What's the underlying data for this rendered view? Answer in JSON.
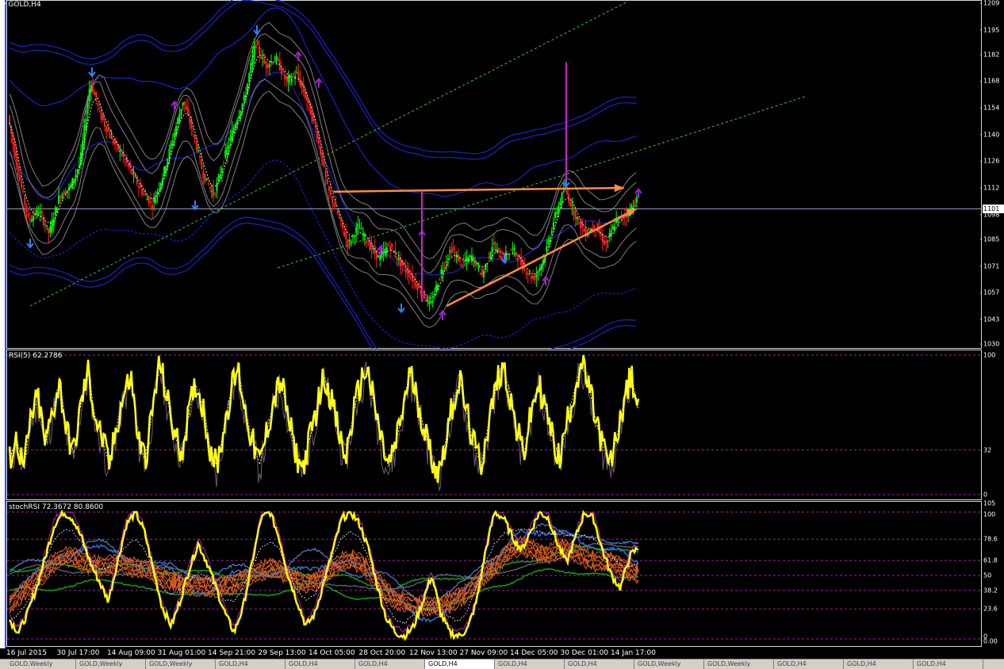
{
  "window": {
    "title": "GOLD,H4"
  },
  "colors": {
    "background": "#000000",
    "bull_candle": "#00ff00",
    "bear_candle": "#ff2020",
    "bollinger": "#1a22c8",
    "envelope": "#808080",
    "trend_orange": "#ff8c40",
    "magenta": "#d020d0",
    "channel_green": "#33cc33",
    "rsi": "#ffff00",
    "stoch_orange": "#e06020",
    "stoch_blue": "#3070e0",
    "stoch_green": "#10a010",
    "level_line": "#a020a0"
  },
  "chart_data": [
    {
      "type": "line",
      "title": "GOLD,H4",
      "ylim": [
        1030,
        1209
      ],
      "yticks": [
        "1209",
        "1195",
        "1182",
        "1168",
        "1154",
        "1140",
        "1126",
        "1112",
        "1098",
        "1085",
        "1071",
        "1057",
        "1043",
        "1030"
      ],
      "ytick_values": [
        1209,
        1195,
        1182,
        1168,
        1154,
        1140,
        1126,
        1112,
        1098,
        1085,
        1071,
        1057,
        1043,
        1030
      ],
      "current_price": 1101.0,
      "current_price_label": "1101",
      "x_labels": [
        "16 Jul 2015",
        "30 Jul 17:00",
        "14 Aug 09:00",
        "31 Aug 01:00",
        "14 Sep 21:00",
        "29 Sep 13:00",
        "14 Oct 05:00",
        "28 Oct 20:00",
        "12 Nov 13:00",
        "27 Nov 09:00",
        "14 Dec 05:00",
        "30 Dec 01:00",
        "14 Jan 17:00"
      ],
      "price_path": [
        [
          0,
          1150
        ],
        [
          0.5,
          1120
        ],
        [
          1,
          1095
        ],
        [
          1.5,
          1100
        ],
        [
          2,
          1088
        ],
        [
          2.5,
          1108
        ],
        [
          3,
          1112
        ],
        [
          3.5,
          1125
        ],
        [
          4,
          1168
        ],
        [
          4.5,
          1150
        ],
        [
          5,
          1138
        ],
        [
          5.5,
          1130
        ],
        [
          6,
          1120
        ],
        [
          6.5,
          1110
        ],
        [
          7,
          1103
        ],
        [
          7.5,
          1118
        ],
        [
          8,
          1138
        ],
        [
          8.5,
          1158
        ],
        [
          9,
          1140
        ],
        [
          9.5,
          1118
        ],
        [
          10,
          1108
        ],
        [
          10.5,
          1128
        ],
        [
          11,
          1145
        ],
        [
          11.5,
          1160
        ],
        [
          12,
          1188
        ],
        [
          12.5,
          1176
        ],
        [
          13,
          1180
        ],
        [
          13.5,
          1168
        ],
        [
          14,
          1172
        ],
        [
          14.5,
          1158
        ],
        [
          15,
          1140
        ],
        [
          15.5,
          1112
        ],
        [
          16,
          1098
        ],
        [
          16.5,
          1082
        ],
        [
          17,
          1092
        ],
        [
          17.5,
          1082
        ],
        [
          18,
          1075
        ],
        [
          18.5,
          1082
        ],
        [
          19,
          1073
        ],
        [
          19.5,
          1066
        ],
        [
          20,
          1058
        ],
        [
          20.5,
          1050
        ],
        [
          21,
          1068
        ],
        [
          21.5,
          1080
        ],
        [
          22,
          1072
        ],
        [
          22.5,
          1076
        ],
        [
          23,
          1066
        ],
        [
          23.5,
          1082
        ],
        [
          24,
          1075
        ],
        [
          24.5,
          1080
        ],
        [
          25,
          1070
        ],
        [
          25.5,
          1064
        ],
        [
          26,
          1075
        ],
        [
          26.5,
          1096
        ],
        [
          27,
          1112
        ],
        [
          27.5,
          1098
        ],
        [
          28,
          1088
        ],
        [
          28.5,
          1092
        ],
        [
          29,
          1082
        ],
        [
          29.5,
          1095
        ],
        [
          30,
          1098
        ],
        [
          30.5,
          1106
        ]
      ],
      "up_markers": [
        [
          1,
          1082
        ],
        [
          4,
          1172
        ],
        [
          9,
          1102
        ],
        [
          12,
          1194
        ],
        [
          19,
          1048
        ],
        [
          24,
          1074
        ],
        [
          27,
          1114
        ]
      ],
      "down_markers": [
        [
          8,
          1156
        ],
        [
          14,
          1182
        ],
        [
          15,
          1168
        ],
        [
          18,
          1080
        ],
        [
          20,
          1088
        ],
        [
          21,
          1046
        ],
        [
          26,
          1064
        ],
        [
          30.5,
          1110
        ]
      ],
      "trendlines": [
        {
          "name": "resistance",
          "from": [
            15.7,
            1110
          ],
          "to": [
            29.8,
            1112
          ],
          "style": "arrow"
        },
        {
          "name": "support",
          "from": [
            21.2,
            1050
          ],
          "to": [
            30.4,
            1101
          ],
          "style": "arrow"
        },
        {
          "name": "target-up",
          "from": [
            27.0,
            1116
          ],
          "to": [
            27.0,
            1178
          ],
          "style": "magenta"
        },
        {
          "name": "target-down",
          "from": [
            20.0,
            1110
          ],
          "to": [
            20.0,
            1052
          ],
          "style": "magenta"
        }
      ],
      "channels": [
        {
          "from": [
            1.0,
            1050
          ],
          "to": [
            30.0,
            1210
          ]
        },
        {
          "from": [
            13.0,
            1070
          ],
          "to": [
            38.6,
            1160
          ]
        }
      ]
    },
    {
      "type": "line",
      "title": "RSI(5) 62.2786",
      "ylim": [
        0,
        100
      ],
      "yticks": [
        "100",
        "32",
        "0"
      ],
      "ytick_values": [
        100,
        32,
        0
      ],
      "levels": [
        100,
        32,
        0
      ],
      "series": [
        {
          "name": "RSI(5)",
          "values": [
            25,
            40,
            18,
            55,
            70,
            35,
            60,
            80,
            45,
            30,
            65,
            88,
            55,
            40,
            20,
            50,
            72,
            85,
            40,
            25,
            60,
            95,
            70,
            45,
            30,
            55,
            80,
            65,
            35,
            20,
            48,
            75,
            90,
            60,
            38,
            22,
            45,
            68,
            82,
            55,
            30,
            18,
            40,
            62,
            85,
            70,
            45,
            25,
            55,
            78,
            92,
            65,
            40,
            20,
            35,
            60,
            88,
            70,
            48,
            28,
            15,
            38,
            65,
            82,
            58,
            35,
            22,
            50,
            76,
            94,
            72,
            45,
            30,
            58,
            80,
            62,
            40,
            25,
            52,
            74,
            95,
            78,
            55,
            35,
            20,
            42,
            68,
            85,
            62
          ]
        }
      ],
      "last_value": 62.2786
    },
    {
      "type": "line",
      "title": "stochRSI 72.3672 80.8600",
      "ylim": [
        0,
        105
      ],
      "yticks": [
        "105",
        "100",
        "78.6",
        "61.8",
        "50",
        "38.2",
        "23.6",
        "0",
        "0.00"
      ],
      "ytick_values": [
        105,
        100,
        78.6,
        61.8,
        50,
        38.2,
        23.6,
        0,
        0
      ],
      "levels": [
        100,
        78.6,
        61.8,
        50,
        38.2,
        23.6,
        0
      ],
      "series": [
        {
          "name": "stochRSI",
          "values": [
            15,
            5,
            20,
            40,
            65,
            90,
            100,
            95,
            80,
            60,
            45,
            30,
            60,
            90,
            100,
            85,
            55,
            25,
            10,
            30,
            55,
            75,
            60,
            40,
            20,
            5,
            25,
            60,
            95,
            100,
            80,
            50,
            30,
            10,
            20,
            45,
            70,
            95,
            100,
            90,
            70,
            40,
            15,
            5,
            2,
            10,
            30,
            50,
            20,
            5,
            2,
            8,
            30,
            70,
            100,
            95,
            80,
            70,
            85,
            100,
            95,
            75,
            60,
            80,
            100,
            95,
            70,
            50,
            40,
            65,
            72
          ]
        }
      ],
      "last_value": 72.3672,
      "signal_value": 80.86
    }
  ],
  "tabs": [
    "GOLD,Weekly",
    "GOLD,Weekly",
    "GOLD,Weekly",
    "GOLD,H4",
    "GOLD,H4",
    "GOLD,H4",
    "GOLD,H4",
    "GOLD,H4",
    "GOLD,H4",
    "GOLD,Weekly",
    "GOLD,Weekly",
    "GOLD,H4",
    "GOLD,H4",
    "GOLD,H4"
  ]
}
